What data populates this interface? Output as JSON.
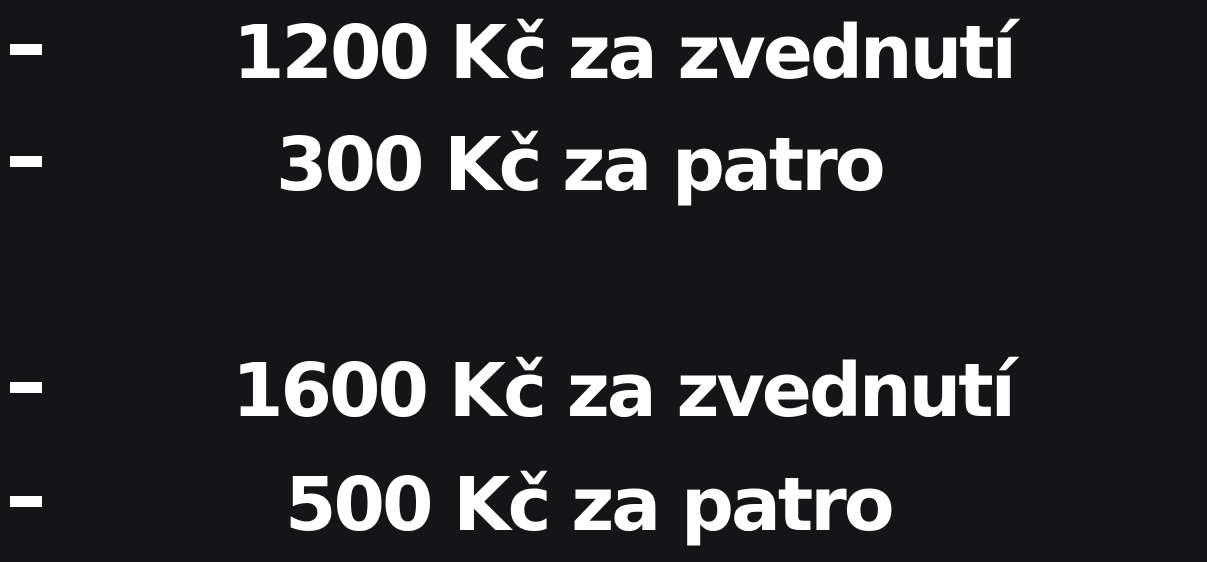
{
  "price_list": {
    "items": [
      {
        "bullet": "-",
        "text": "1200 Kč za zvednutí"
      },
      {
        "bullet": "-",
        "text": "300 Kč za patro"
      },
      {
        "bullet": "-",
        "text": "1600 Kč za zvednutí"
      },
      {
        "bullet": "-",
        "text": "500 Kč za patro"
      }
    ]
  },
  "colors": {
    "background": "#151517",
    "text": "#ffffff"
  }
}
